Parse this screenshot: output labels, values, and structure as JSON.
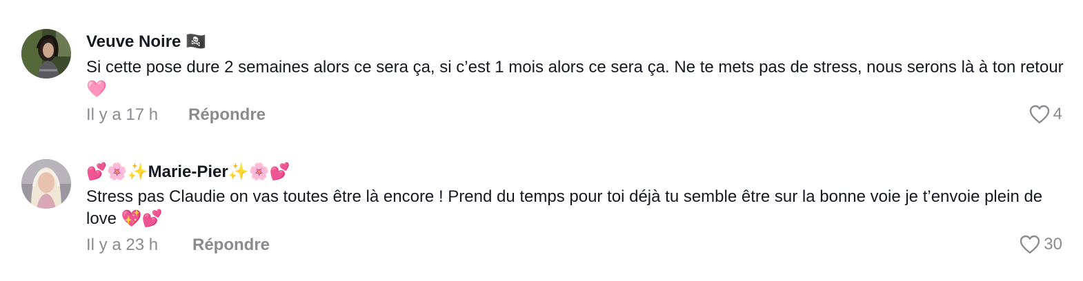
{
  "comments": [
    {
      "username": "Veuve Noire 🏴‍☠️",
      "text": "Si cette pose dure 2 semaines alors ce sera ça, si c’est 1 mois alors ce sera ça. Ne te mets pas de stress, nous serons là à ton retour 🩷",
      "time": "Il y a 17 h",
      "reply_label": "Répondre",
      "likes": "4"
    },
    {
      "username": "💕🌸✨Marie-Pier✨🌸💕",
      "text": "Stress pas Claudie on vas toutes être là encore ! Prend du temps pour toi déjà tu semble être sur la bonne voie je t’envoie plein de love 💖💕",
      "time": "Il y a 23 h",
      "reply_label": "Répondre",
      "likes": "30"
    }
  ],
  "icons": {
    "like": "heart-outline-icon"
  },
  "colors": {
    "primary_text": "#161823",
    "secondary_text": "#8a8b91"
  }
}
